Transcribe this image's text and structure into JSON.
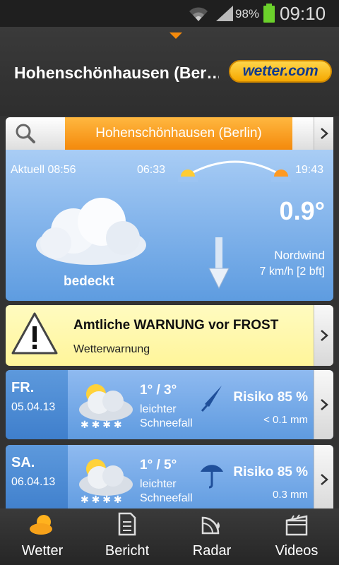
{
  "status_bar": {
    "battery_percent": "98%",
    "time": "09:10",
    "icons": [
      "wifi-icon",
      "signal-icon",
      "battery-icon"
    ]
  },
  "header": {
    "location_title": "Hohenschönhausen (Ber…",
    "logo_text": "wetter.com"
  },
  "location_bar": {
    "selected_location": "Hohenschönhausen (Berlin)"
  },
  "current": {
    "time_label": "Aktuell 08:56",
    "sunrise": "06:33",
    "sunset": "19:43",
    "condition": "bedeckt",
    "temperature": "0.9°",
    "wind_direction": "Nordwind",
    "wind_speed": "7 km/h [2 bft]"
  },
  "warning": {
    "title": "Amtliche WARNUNG vor FROST",
    "subtitle": "Wetterwarnung"
  },
  "forecast": [
    {
      "day": "FR.",
      "date": "05.04.13",
      "temps": "1° / 3°",
      "desc_line1": "leichter",
      "desc_line2": "Schneefall",
      "risk": "Risiko 85 %",
      "amount": "< 0.1 mm"
    },
    {
      "day": "SA.",
      "date": "06.04.13",
      "temps": "1° / 5°",
      "desc_line1": "leichter",
      "desc_line2": "Schneefall",
      "risk": "Risiko 85 %",
      "amount": "0.3 mm"
    }
  ],
  "bottom_nav": [
    {
      "label": "Wetter",
      "icon": "weather-icon"
    },
    {
      "label": "Bericht",
      "icon": "report-icon"
    },
    {
      "label": "Radar",
      "icon": "radar-icon"
    },
    {
      "label": "Videos",
      "icon": "video-icon"
    }
  ],
  "colors": {
    "accent_orange": "#f48a0c",
    "sky_blue": "#86b6ec",
    "warning_yellow": "#fff59a",
    "logo_blue": "#123a8c"
  }
}
